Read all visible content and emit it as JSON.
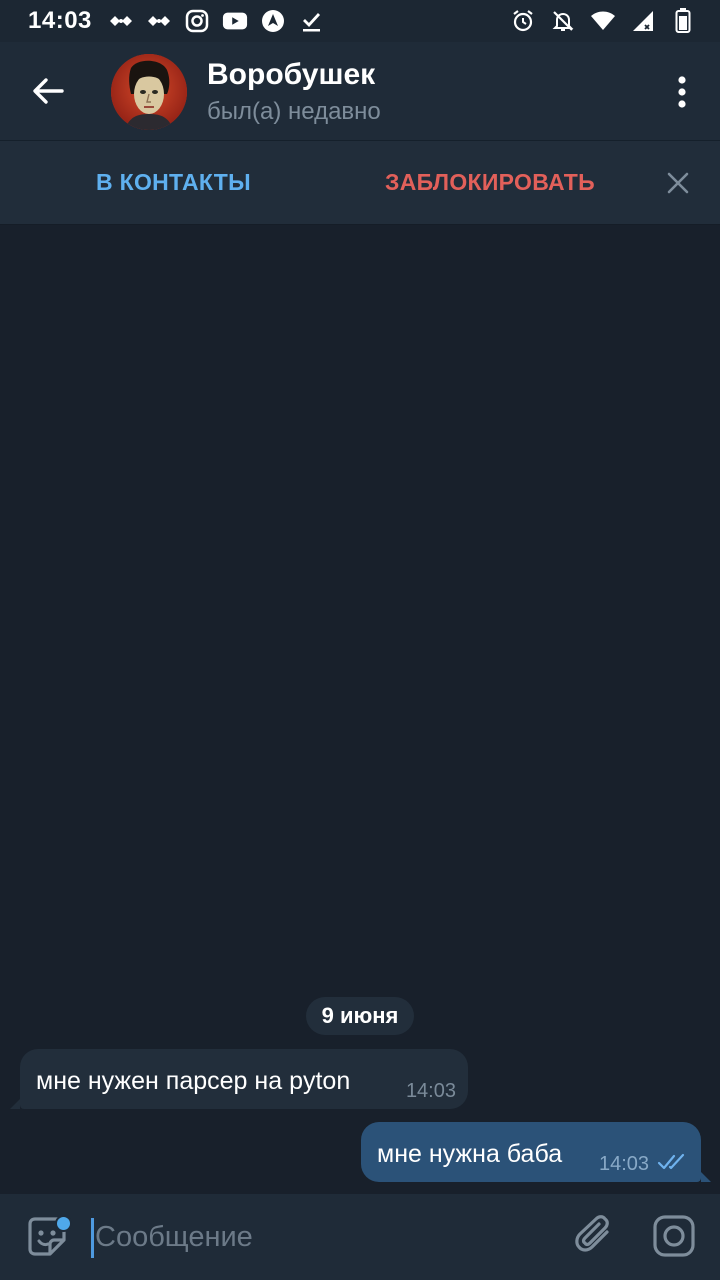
{
  "status_bar": {
    "time": "14:03"
  },
  "header": {
    "contact_name": "Воробушек",
    "last_seen": "был(а) недавно"
  },
  "action_bar": {
    "add_contact": "В КОНТАКТЫ",
    "block": "ЗАБЛОКИРОВАТЬ"
  },
  "messages": {
    "date": "9 июня",
    "items": [
      {
        "direction": "in",
        "text": "мне нужен парсер на pyton",
        "time": "14:03"
      },
      {
        "direction": "out",
        "text": "мне нужна баба",
        "time": "14:03",
        "status": "read"
      }
    ]
  },
  "composer": {
    "placeholder": "Сообщение"
  },
  "colors": {
    "background": "#18202b",
    "header": "#1f2b38",
    "accent": "#5fb0ef",
    "danger": "#e2605a",
    "bubble_in": "#222e3b",
    "bubble_out": "#2b5278"
  }
}
